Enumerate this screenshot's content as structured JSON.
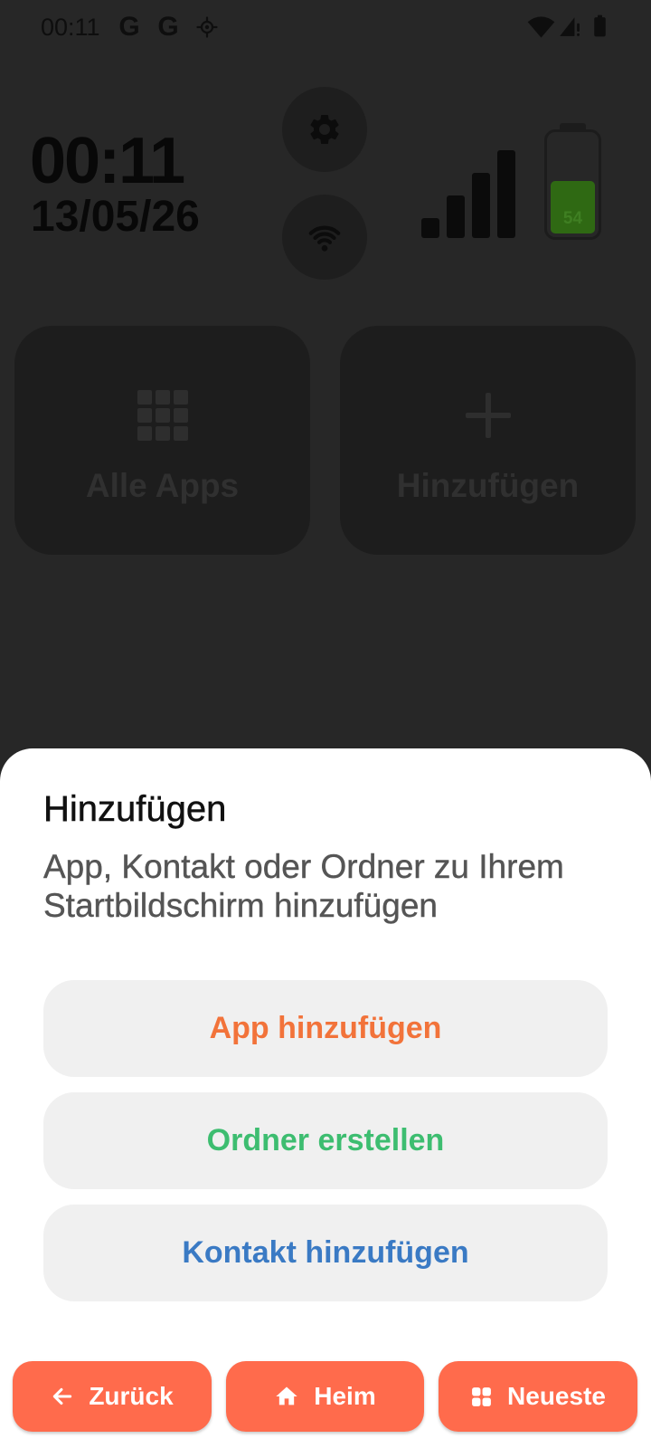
{
  "status_bar": {
    "time": "00:11",
    "notification_icons": [
      "google-icon",
      "google-icon",
      "location-icon"
    ],
    "system_icons": [
      "wifi-icon",
      "signal-icon",
      "battery-icon"
    ]
  },
  "home": {
    "clock": "00:11",
    "date": "13/05/26",
    "quick_buttons": [
      {
        "icon": "gear-icon"
      },
      {
        "icon": "wifi-icon"
      }
    ],
    "signal_level": 4,
    "battery": {
      "level": 54,
      "label": "54"
    }
  },
  "tiles": [
    {
      "label": "Alle Apps",
      "icon": "grid-icon"
    },
    {
      "label": "Hinzufügen",
      "icon": "plus-icon"
    }
  ],
  "sheet": {
    "title": "Hinzufügen",
    "subtitle": "App, Kontakt oder Ordner zu Ihrem Startbildschirm hinzufügen",
    "actions": [
      {
        "label": "App hinzufügen",
        "color": "#f2733a"
      },
      {
        "label": "Ordner erstellen",
        "color": "#3dbd70"
      },
      {
        "label": "Kontakt hinzufügen",
        "color": "#3a7ac4"
      }
    ]
  },
  "nav": {
    "buttons": [
      {
        "label": "Zurück",
        "icon": "arrow-left-icon"
      },
      {
        "label": "Heim",
        "icon": "home-icon"
      },
      {
        "label": "Neueste",
        "icon": "recents-icon"
      }
    ]
  },
  "colors": {
    "background": "#272727",
    "sheet": "#ffffff",
    "action_bg": "#f0f0f0",
    "nav_bg": "#ff6b4c",
    "battery_fill": "#2f6913"
  }
}
